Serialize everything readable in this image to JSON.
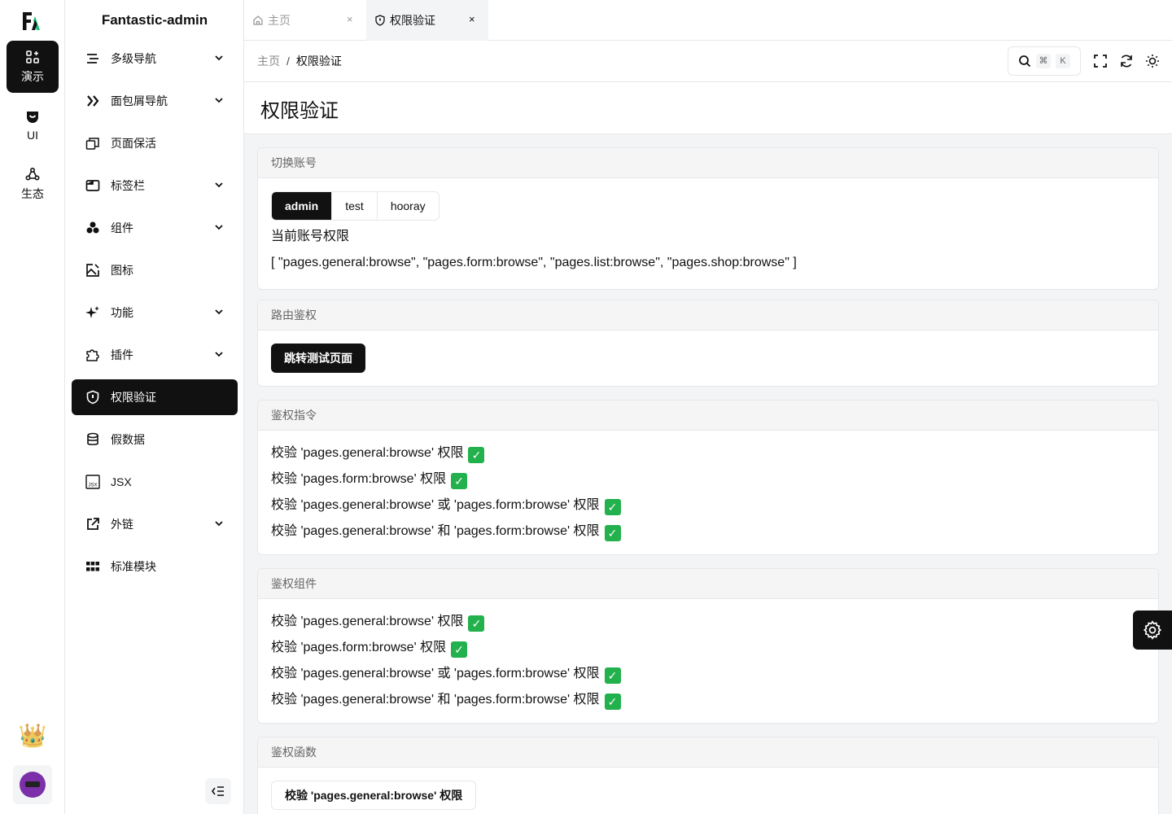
{
  "rail": {
    "items": [
      {
        "label": "演示",
        "icon": "grid-apps-icon",
        "active": true
      },
      {
        "label": "UI",
        "icon": "cup-icon",
        "active": false
      },
      {
        "label": "生态",
        "icon": "ecosystem-icon",
        "active": false
      }
    ]
  },
  "sidebar": {
    "title": "Fantastic-admin",
    "items": [
      {
        "label": "多级导航",
        "icon": "list-nested-icon",
        "expandable": true
      },
      {
        "label": "面包屑导航",
        "icon": "double-chevron-right-icon",
        "expandable": true
      },
      {
        "label": "页面保活",
        "icon": "windows-stack-icon",
        "expandable": false
      },
      {
        "label": "标签栏",
        "icon": "tab-window-icon",
        "expandable": true
      },
      {
        "label": "组件",
        "icon": "components-icon",
        "expandable": true
      },
      {
        "label": "图标",
        "icon": "image-edit-icon",
        "expandable": false
      },
      {
        "label": "功能",
        "icon": "sparkles-icon",
        "expandable": true
      },
      {
        "label": "插件",
        "icon": "puzzle-icon",
        "expandable": true
      },
      {
        "label": "权限验证",
        "icon": "shield-icon",
        "expandable": false,
        "active": true
      },
      {
        "label": "假数据",
        "icon": "database-icon",
        "expandable": false
      },
      {
        "label": "JSX",
        "icon": "jsx-icon",
        "expandable": false
      },
      {
        "label": "外链",
        "icon": "external-link-icon",
        "expandable": true
      },
      {
        "label": "标准模块",
        "icon": "modules-grid-icon",
        "expandable": false
      }
    ]
  },
  "tabs": [
    {
      "label": "主页",
      "icon": "home-icon",
      "active": false
    },
    {
      "label": "权限验证",
      "icon": "shield-icon",
      "active": true
    }
  ],
  "toolbar": {
    "breadcrumb": [
      "主页",
      "权限验证"
    ],
    "search_kbd": [
      "⌘",
      "K"
    ]
  },
  "page": {
    "title": "权限验证",
    "account": {
      "header": "切换账号",
      "options": [
        "admin",
        "test",
        "hooray"
      ],
      "selected": "admin",
      "perm_label": "当前账号权限",
      "perm_value": "[ \"pages.general:browse\", \"pages.form:browse\", \"pages.list:browse\", \"pages.shop:browse\" ]"
    },
    "route": {
      "header": "路由鉴权",
      "button": "跳转测试页面"
    },
    "directive": {
      "header": "鉴权指令",
      "lines": [
        "校验 'pages.general:browse' 权限",
        "校验 'pages.form:browse' 权限",
        "校验 'pages.general:browse' 或 'pages.form:browse' 权限",
        "校验 'pages.general:browse' 和 'pages.form:browse' 权限"
      ]
    },
    "component": {
      "header": "鉴权组件",
      "lines": [
        "校验 'pages.general:browse' 权限",
        "校验 'pages.form:browse' 权限",
        "校验 'pages.general:browse' 或 'pages.form:browse' 权限",
        "校验 'pages.general:browse' 和 'pages.form:browse' 权限"
      ]
    },
    "function": {
      "header": "鉴权函数",
      "button": "校验 'pages.general:browse' 权限"
    }
  },
  "check_mark": "✓",
  "colors": {
    "accent": "#111111",
    "check": "#22b14c"
  }
}
